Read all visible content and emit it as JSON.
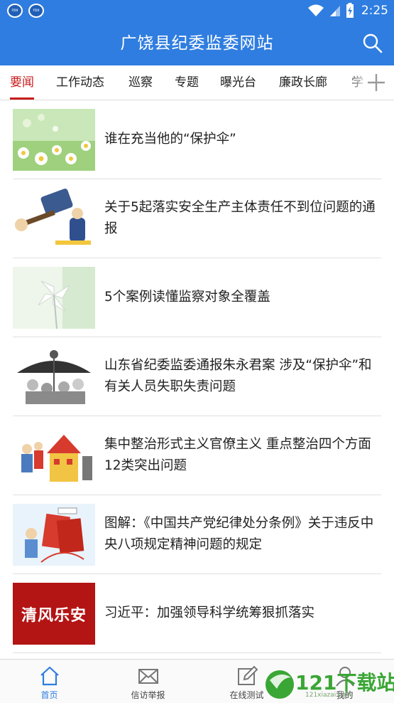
{
  "status_bar": {
    "app_icons": [
      "rox",
      "rox"
    ],
    "time": "2:25"
  },
  "header": {
    "title": "广饶县纪委监委网站",
    "search_icon": "search-icon"
  },
  "tabs": {
    "items": [
      {
        "label": "要闻",
        "active": true
      },
      {
        "label": "工作动态",
        "active": false
      },
      {
        "label": "巡察",
        "active": false
      },
      {
        "label": "专题",
        "active": false
      },
      {
        "label": "曝光台",
        "active": false
      },
      {
        "label": "廉政长廊",
        "active": false
      },
      {
        "label": "学",
        "active": false
      }
    ],
    "add_icon": "plus-icon"
  },
  "news": [
    {
      "title": "谁在充当他的“保护伞”",
      "thumb": "flowers-image"
    },
    {
      "title": "关于5起落实安全生产主体责任不到位问题的通报",
      "thumb": "gavel-cartoon-image"
    },
    {
      "title": "5个案例读懂监察对象全覆盖",
      "thumb": "pinwheel-image"
    },
    {
      "title": "山东省纪委监委通报朱永君案 涉及“保护伞”和有关人员失职失责问题",
      "thumb": "umbrella-cartoon-image"
    },
    {
      "title": "集中整治形式主义官僚主义 重点整治四个方面12类突出问题",
      "thumb": "house-cartoon-image"
    },
    {
      "title": "图解：《中国共产党纪律处分条例》关于违反中央八项规定精神问题的规定",
      "thumb": "regulation-cartoon-image"
    },
    {
      "title": "习近平：加强领导科学统筹狠抓落实",
      "thumb": "calligraphy-banner-image",
      "thumb_text": "清风乐安"
    }
  ],
  "bottom_nav": [
    {
      "label": "首页",
      "icon": "home-icon",
      "active": true
    },
    {
      "label": "信访举报",
      "icon": "mail-icon",
      "active": false
    },
    {
      "label": "在线测试",
      "icon": "edit-icon",
      "active": false
    },
    {
      "label": "我的",
      "icon": "user-icon",
      "active": false
    }
  ],
  "watermark": {
    "text": "121下载站",
    "subtext": "121xiazai.com"
  },
  "colors": {
    "primary": "#2f7de0",
    "accent": "#c81e1e",
    "text": "#222222"
  }
}
